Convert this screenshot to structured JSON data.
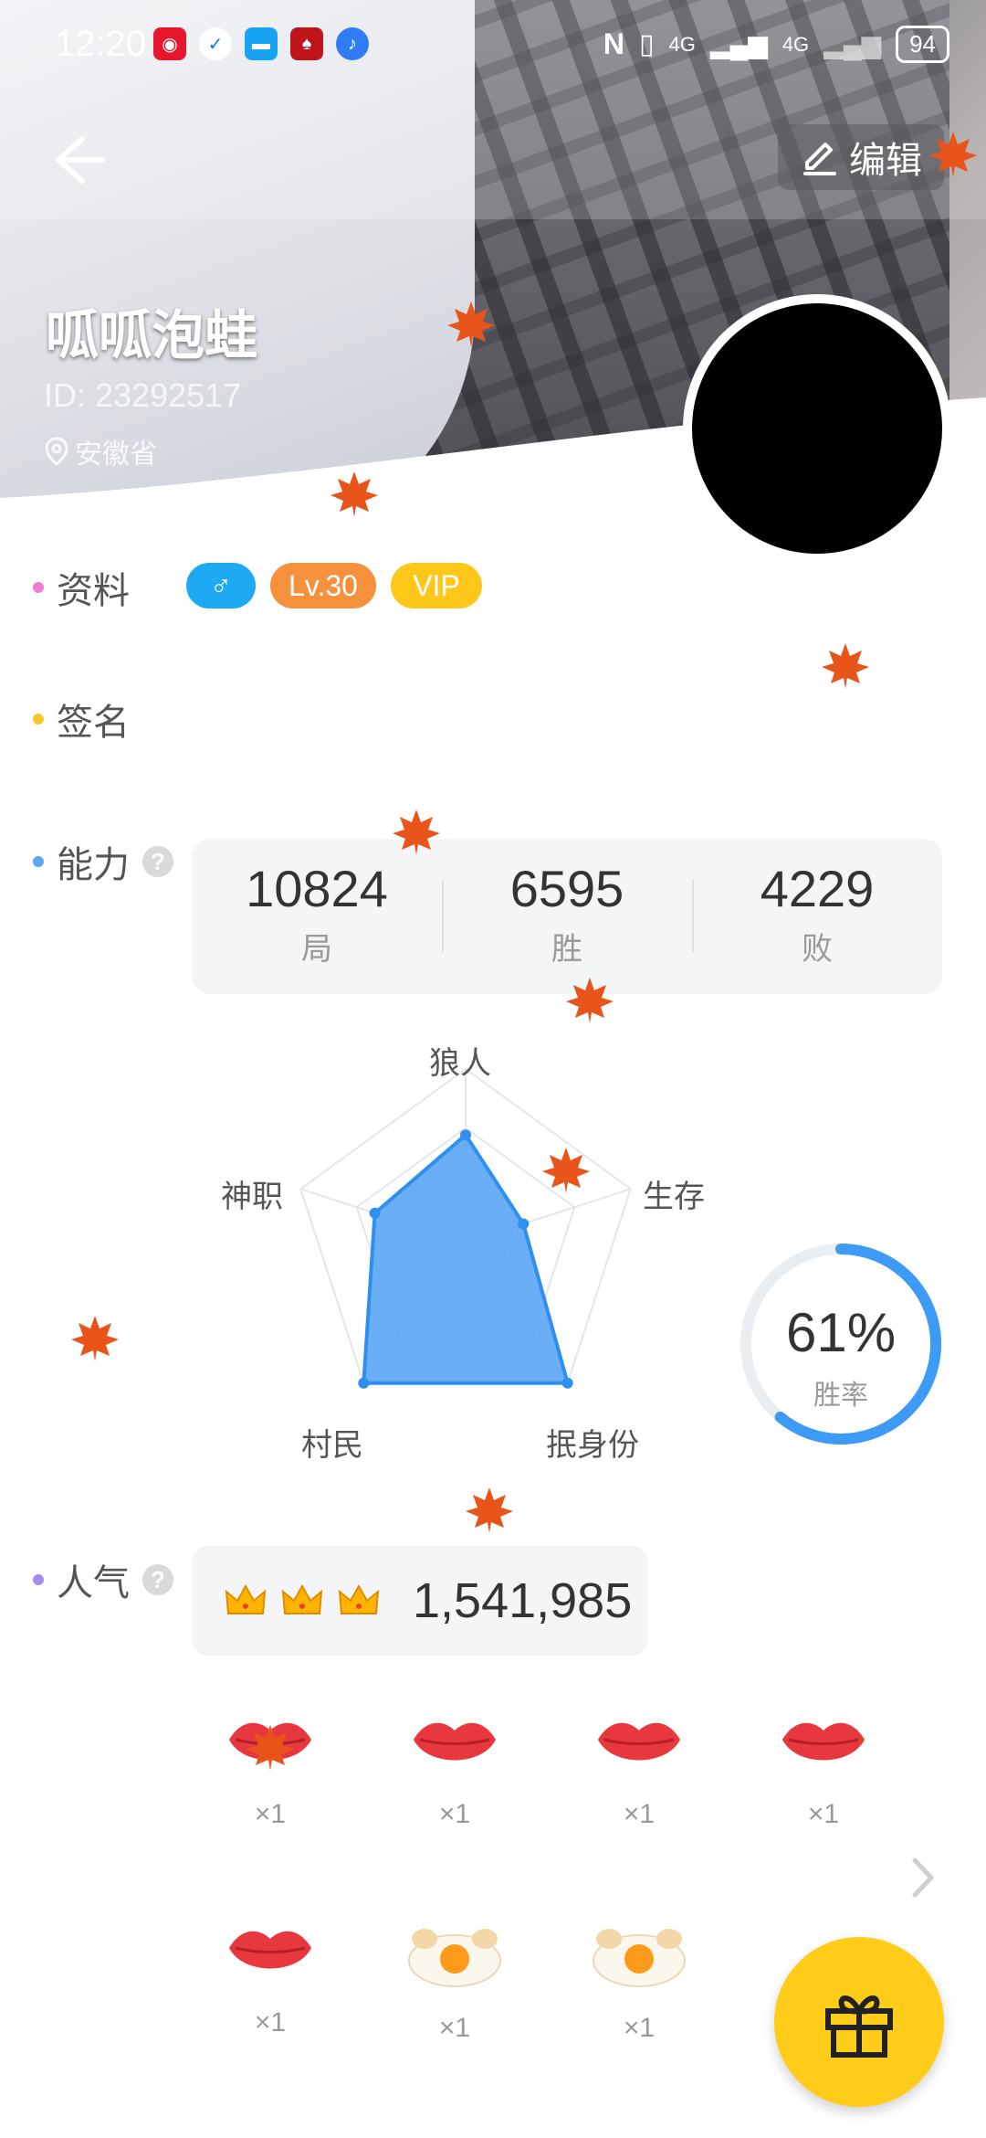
{
  "status_bar": {
    "time": "12:20",
    "signal_1": "4G",
    "signal_2": "4G",
    "battery": "94"
  },
  "header": {
    "back_icon": "arrow-left-icon",
    "edit_label": "编辑",
    "username": "呱呱泡蛙",
    "user_id": "ID: 23292517",
    "location": "安徽省"
  },
  "profile": {
    "label": "资料",
    "gender_symbol": "♂",
    "level": "Lv.30",
    "vip": "VIP"
  },
  "signature": {
    "label": "签名"
  },
  "ability": {
    "label": "能力",
    "help": "?",
    "stats": [
      {
        "value": "10824",
        "label": "局"
      },
      {
        "value": "6595",
        "label": "胜"
      },
      {
        "value": "4229",
        "label": "败"
      }
    ],
    "radar": {
      "axes": [
        "狼人",
        "生存",
        "抿身份",
        "村民",
        "神职"
      ],
      "values": [
        0.62,
        0.35,
        1.0,
        1.0,
        0.55
      ]
    },
    "win_rate": {
      "value": "61%",
      "label": "胜率",
      "fraction": 0.61
    }
  },
  "popularity": {
    "label": "人气",
    "help": "?",
    "value": "1,541,985",
    "crowns": 3
  },
  "gifts": {
    "row1": [
      {
        "icon": "lips-icon",
        "count": "×1"
      },
      {
        "icon": "lips-icon",
        "count": "×1"
      },
      {
        "icon": "lips-icon",
        "count": "×1"
      },
      {
        "icon": "lips-icon",
        "count": "×1"
      }
    ],
    "row2": [
      {
        "icon": "lips-icon",
        "count": "×1"
      },
      {
        "icon": "fried-egg-icon",
        "count": "×1"
      },
      {
        "icon": "fried-egg-icon",
        "count": "×1"
      }
    ]
  },
  "colors": {
    "accent_blue": "#3d9bf5",
    "level_orange": "#f5903d",
    "vip_yellow": "#ffc71a",
    "gender_blue": "#1fa9f2",
    "gift_fab": "#ffcc1a"
  }
}
